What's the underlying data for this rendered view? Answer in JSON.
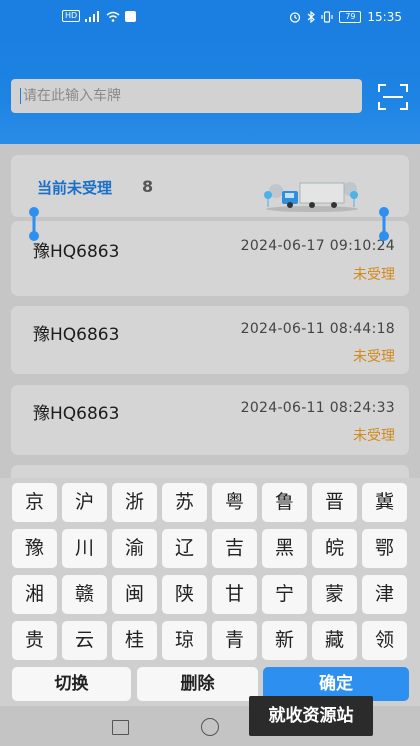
{
  "status_bar": {
    "hd": "HD",
    "battery": "79",
    "time": "15:35"
  },
  "search": {
    "placeholder": "请在此输入车牌"
  },
  "summary": {
    "label": "当前未受理",
    "count": "8"
  },
  "records": [
    {
      "plate": "豫HQ6863",
      "time": "2024-06-17 09:10:24",
      "status": "未受理"
    },
    {
      "plate": "豫HQ6863",
      "time": "2024-06-11 08:44:18",
      "status": "未受理"
    },
    {
      "plate": "豫HQ6863",
      "time": "2024-06-11 08:24:33",
      "status": "未受理"
    }
  ],
  "keyboard": {
    "rows": [
      [
        "京",
        "沪",
        "浙",
        "苏",
        "粤",
        "鲁",
        "晋",
        "冀"
      ],
      [
        "豫",
        "川",
        "渝",
        "辽",
        "吉",
        "黑",
        "皖",
        "鄂"
      ],
      [
        "湘",
        "赣",
        "闽",
        "陕",
        "甘",
        "宁",
        "蒙",
        "津"
      ],
      [
        "贵",
        "云",
        "桂",
        "琼",
        "青",
        "新",
        "藏",
        "领"
      ]
    ],
    "switch_label": "切换",
    "delete_label": "删除",
    "confirm_label": "确定"
  },
  "watermark": "就收资源站",
  "colors": {
    "primary": "#1a7fe0",
    "status_pending": "#d2891a",
    "confirm": "#2d8ff0"
  },
  "icons": [
    "signal-icon",
    "wifi-icon",
    "alarm-icon",
    "bluetooth-icon",
    "vibrate-icon",
    "battery-icon",
    "scan-icon",
    "truck-illustration",
    "selection-handle-icon",
    "recents-icon",
    "home-icon"
  ]
}
